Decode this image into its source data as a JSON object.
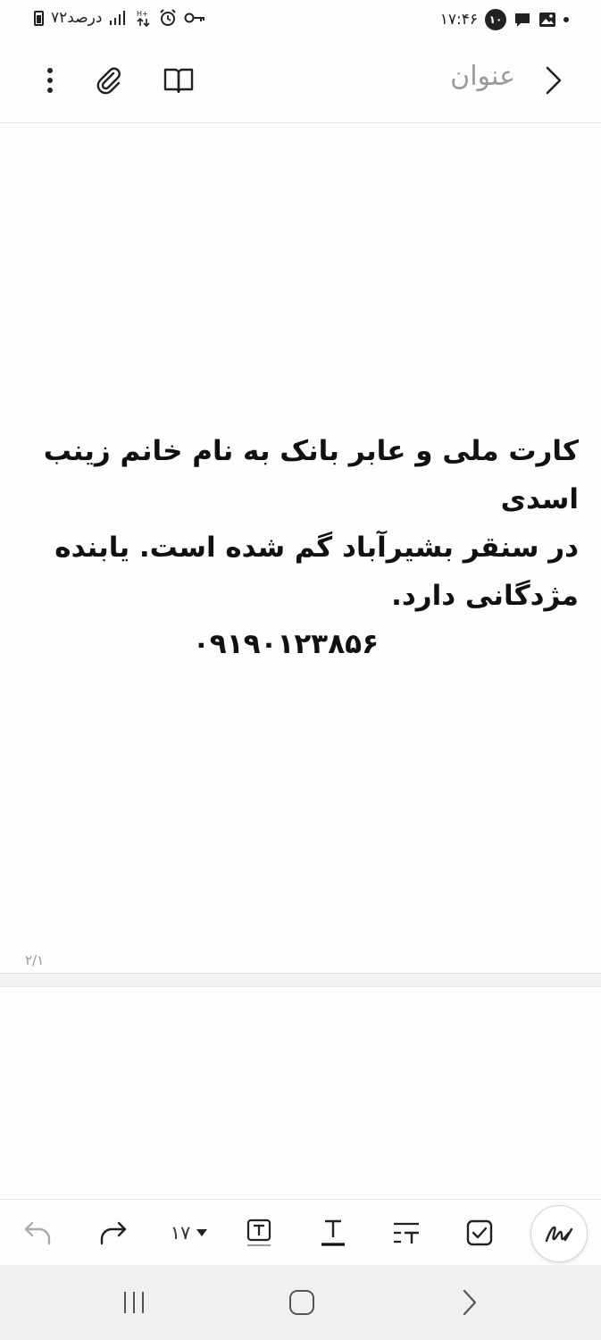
{
  "status_bar": {
    "time": "۱۷:۴۶",
    "notification_count": "۱۰",
    "battery_text": "۷۲درصد"
  },
  "toolbar": {
    "title_placeholder": "عنوان"
  },
  "note": {
    "lines": [
      "کارت ملی و عابر بانک به نام خانم زینب اسدی",
      "در سنقر بشیرآباد گم شده است. یابنده",
      "مژدگانی دارد.",
      "۰۹۱۹۰۱۲۳۸۵۶"
    ]
  },
  "page_indicator": "۲/۱",
  "format_bar": {
    "font_size": "۱۷"
  },
  "icons": {
    "back": "chevron-right-icon",
    "reading_mode": "book-icon",
    "attach": "paperclip-icon",
    "more": "more-vertical-icon",
    "undo": "undo-icon",
    "redo": "redo-icon",
    "text_style": "text-box-icon",
    "text_color": "text-underline-icon",
    "paragraph": "paragraph-icon",
    "checklist": "checkbox-icon",
    "handwriting": "pen-icon"
  }
}
